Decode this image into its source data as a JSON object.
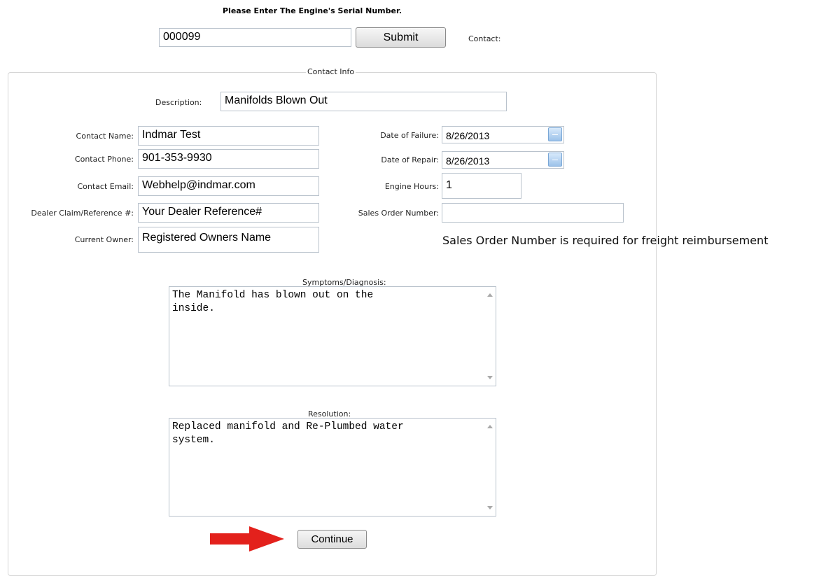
{
  "header": {
    "prompt": "Please Enter The Engine's Serial Number.",
    "serial_value": "000099",
    "submit_label": "Submit",
    "contact_label": "Contact:"
  },
  "contact_info": {
    "legend": "Contact Info",
    "description": {
      "label": "Description:",
      "value": "Manifolds Blown Out"
    },
    "contact_name": {
      "label": "Contact Name:",
      "value": "Indmar Test"
    },
    "contact_phone": {
      "label": "Contact Phone:",
      "value": "901-353-9930"
    },
    "contact_email": {
      "label": "Contact Email:",
      "value": "Webhelp@indmar.com"
    },
    "dealer_ref": {
      "label": "Dealer Claim/Reference #:",
      "value": "Your Dealer Reference#"
    },
    "current_owner": {
      "label": "Current Owner:",
      "value": "Registered Owners Name"
    },
    "date_failure": {
      "label": "Date of Failure:",
      "value": "8/26/2013"
    },
    "date_repair": {
      "label": "Date of Repair:",
      "value": "8/26/2013"
    },
    "engine_hours": {
      "label": "Engine Hours:",
      "value": "1"
    },
    "sales_order": {
      "label": "Sales Order Number:",
      "value": ""
    },
    "sales_order_note": "Sales Order Number is required for freight reimbursement",
    "symptoms": {
      "label": "Symptoms/Diagnosis:",
      "value": "The Manifold has blown out on the\ninside."
    },
    "resolution": {
      "label": "Resolution:",
      "value": "Replaced manifold and Re-Plumbed water\nsystem."
    },
    "continue_label": "Continue"
  },
  "colors": {
    "arrow": "#e3211c",
    "calendar_button": "#9cc2ea",
    "input_border": "#b9c2cc"
  }
}
